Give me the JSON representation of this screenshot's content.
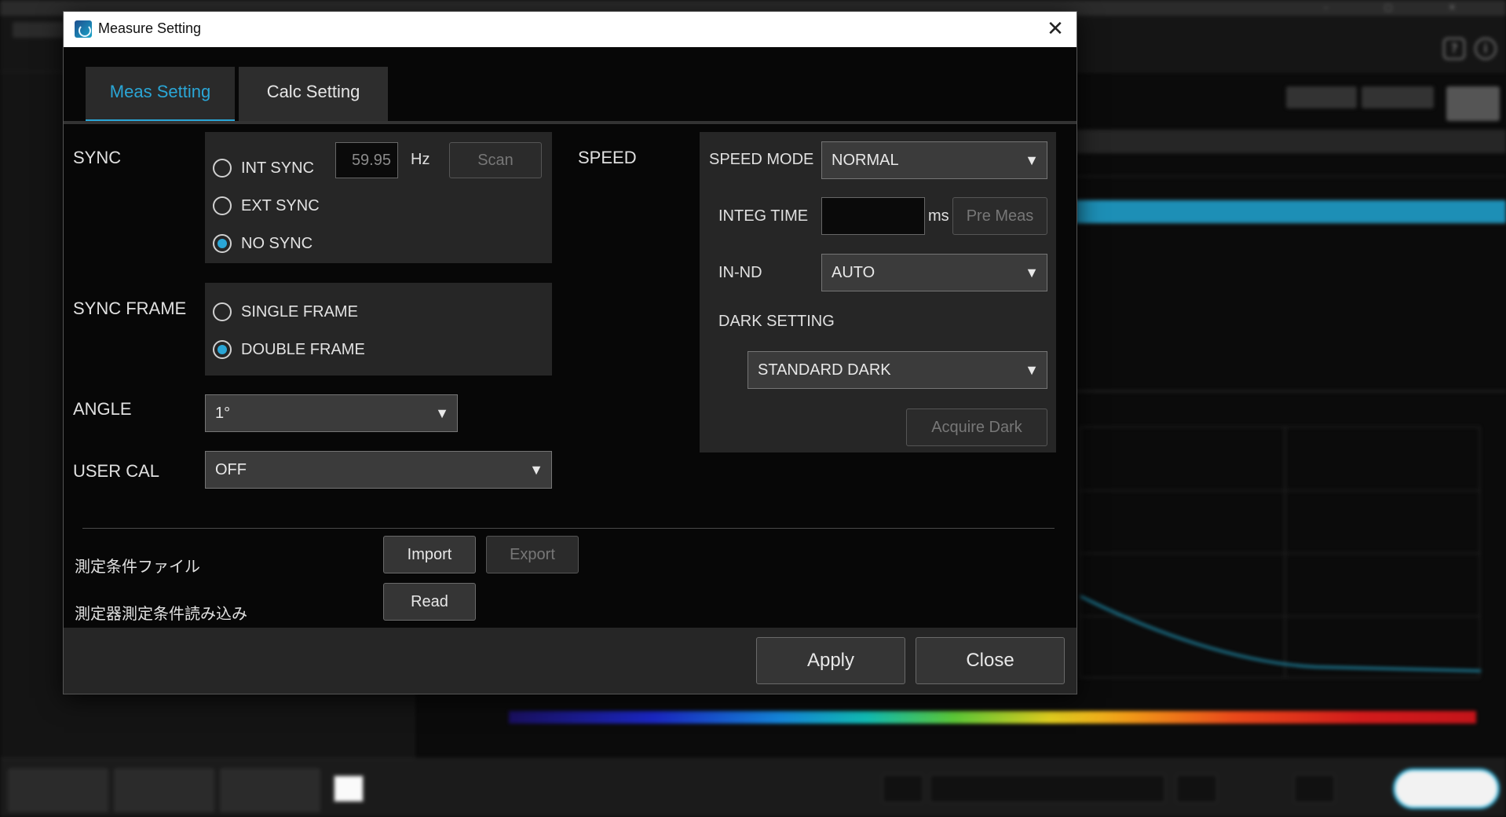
{
  "dialog": {
    "title": "Measure Setting",
    "tabs": [
      {
        "label": "Meas Setting",
        "active": true
      },
      {
        "label": "Calc Setting",
        "active": false
      }
    ],
    "sync": {
      "label": "SYNC",
      "options": [
        {
          "label": "INT SYNC",
          "selected": false
        },
        {
          "label": "EXT SYNC",
          "selected": false
        },
        {
          "label": "NO SYNC",
          "selected": true
        }
      ],
      "frequency": "59.95",
      "unit": "Hz",
      "scan_label": "Scan"
    },
    "sync_frame": {
      "label": "SYNC FRAME",
      "options": [
        {
          "label": "SINGLE FRAME",
          "selected": false
        },
        {
          "label": "DOUBLE FRAME",
          "selected": true
        }
      ]
    },
    "angle": {
      "label": "ANGLE",
      "value": "1°"
    },
    "user_cal": {
      "label": "USER CAL",
      "value": "OFF"
    },
    "speed": {
      "label": "SPEED",
      "speed_mode_label": "SPEED MODE",
      "speed_mode_value": "NORMAL",
      "integ_time_label": "INTEG TIME",
      "integ_time_value": "",
      "integ_time_unit": "ms",
      "pre_meas_label": "Pre Meas",
      "in_nd_label": "IN-ND",
      "in_nd_value": "AUTO",
      "dark_setting_label": "DARK SETTING",
      "dark_setting_value": "STANDARD DARK",
      "acquire_dark_label": "Acquire Dark"
    },
    "condition_file": {
      "label": "測定条件ファイル",
      "import_label": "Import",
      "export_label": "Export"
    },
    "instrument_read": {
      "label": "測定器測定条件読み込み",
      "read_label": "Read"
    },
    "apply_label": "Apply",
    "close_label": "Close"
  },
  "colors": {
    "accent": "#2aa6d6",
    "panel": "#262626",
    "dialog_bg": "#070707"
  },
  "icons": {
    "app": "app-icon",
    "close": "close-icon",
    "dropdown": "chevron-down-icon"
  }
}
